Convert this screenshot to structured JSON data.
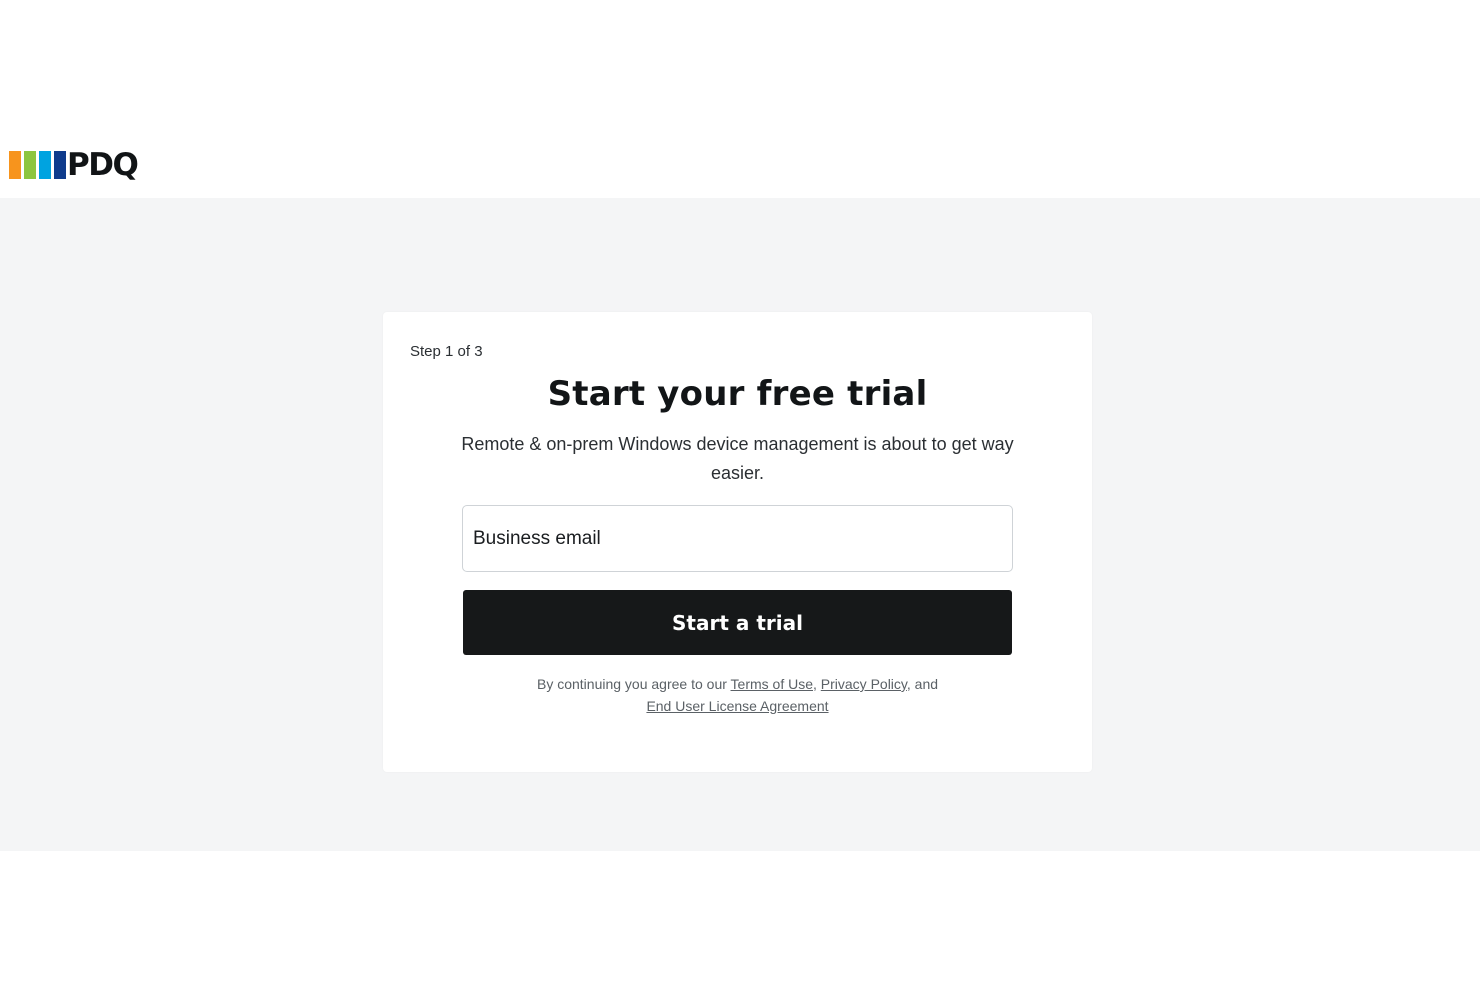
{
  "brand": {
    "name": "PDQ",
    "bar_colors": [
      "#f7941d",
      "#8dc63f",
      "#00a3e0",
      "#0f3b8c"
    ]
  },
  "form": {
    "step": "Step 1 of 3",
    "title": "Start your free trial",
    "subtitle": "Remote & on-prem Windows device management is about to get way easier.",
    "email_placeholder": "Business email",
    "email_value": "",
    "submit_label": "Start a trial"
  },
  "legal": {
    "prefix": "By continuing you agree to our ",
    "terms_label": "Terms of Use",
    "separator": ", ",
    "privacy_label": "Privacy Policy",
    "conjunction": ", and",
    "eula_label": "End User License Agreement"
  },
  "colors": {
    "page_band": "#f4f5f6",
    "card": "#ffffff",
    "button": "#161819",
    "button_text": "#ffffff"
  }
}
